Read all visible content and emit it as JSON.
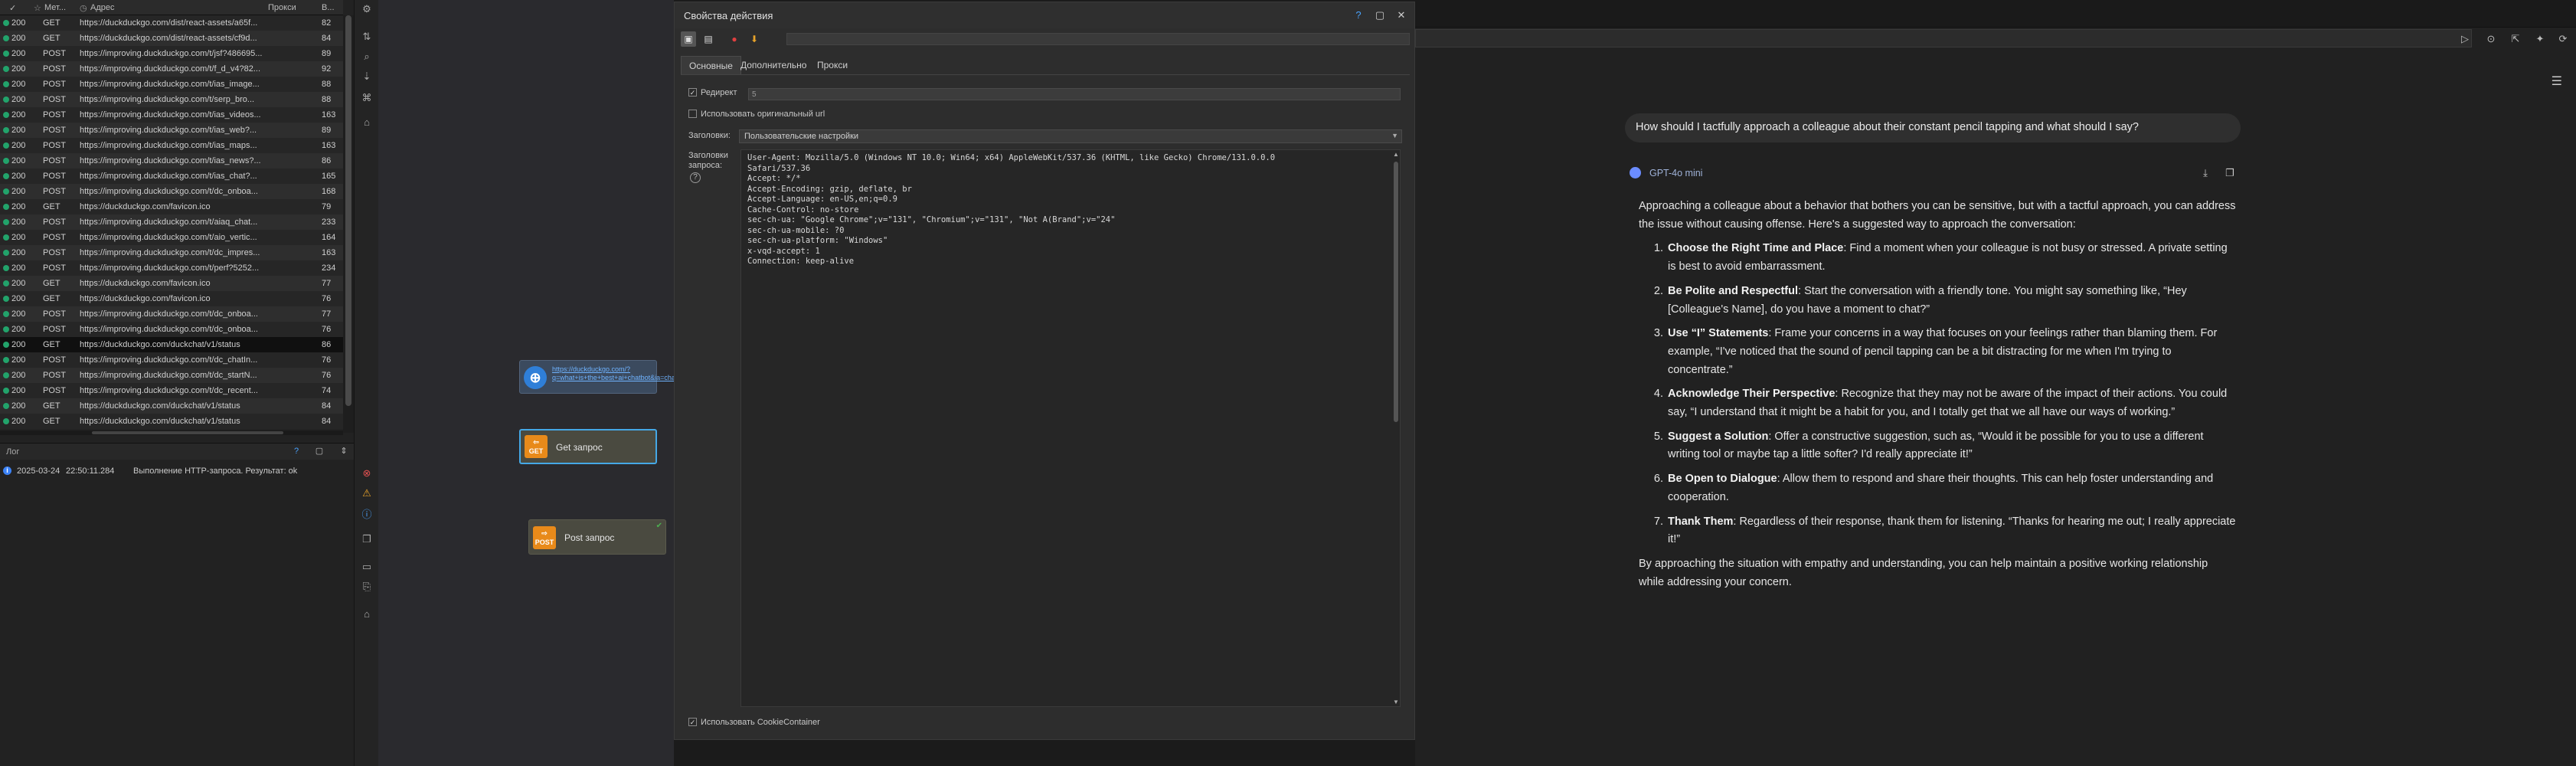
{
  "left_panel": {
    "columns": {
      "check": "✓",
      "method": "Мет...",
      "address": "Адрес",
      "proxy": "Прокси",
      "size": "В..."
    },
    "requests": [
      {
        "status": "200",
        "method": "GET",
        "url": "https://duckduckgo.com/dist/react-assets/a65f...",
        "size": "82",
        "dot": "#22a36b"
      },
      {
        "status": "200",
        "method": "GET",
        "url": "https://duckduckgo.com/dist/react-assets/cf9d...",
        "size": "84",
        "dot": "#22a36b"
      },
      {
        "status": "200",
        "method": "POST",
        "url": "https://improving.duckduckgo.com/t/jsf?486695...",
        "size": "89",
        "dot": "#22a36b"
      },
      {
        "status": "200",
        "method": "POST",
        "url": "https://improving.duckduckgo.com/t/f_d_v4?82...",
        "size": "92",
        "dot": "#22a36b"
      },
      {
        "status": "200",
        "method": "POST",
        "url": "https://improving.duckduckgo.com/t/ias_image...",
        "size": "88",
        "dot": "#22a36b"
      },
      {
        "status": "200",
        "method": "POST",
        "url": "https://improving.duckduckgo.com/t/serp_bro...",
        "size": "88",
        "dot": "#22a36b"
      },
      {
        "status": "200",
        "method": "POST",
        "url": "https://improving.duckduckgo.com/t/ias_videos...",
        "size": "163",
        "dot": "#22a36b"
      },
      {
        "status": "200",
        "method": "POST",
        "url": "https://improving.duckduckgo.com/t/ias_web?...",
        "size": "89",
        "dot": "#22a36b"
      },
      {
        "status": "200",
        "method": "POST",
        "url": "https://improving.duckduckgo.com/t/ias_maps...",
        "size": "163",
        "dot": "#22a36b"
      },
      {
        "status": "200",
        "method": "POST",
        "url": "https://improving.duckduckgo.com/t/ias_news?...",
        "size": "86",
        "dot": "#22a36b"
      },
      {
        "status": "200",
        "method": "POST",
        "url": "https://improving.duckduckgo.com/t/ias_chat?...",
        "size": "165",
        "dot": "#22a36b"
      },
      {
        "status": "200",
        "method": "POST",
        "url": "https://improving.duckduckgo.com/t/dc_onboa...",
        "size": "168",
        "dot": "#22a36b"
      },
      {
        "status": "200",
        "method": "GET",
        "url": "https://duckduckgo.com/favicon.ico",
        "size": "79",
        "dot": "#22a36b"
      },
      {
        "status": "200",
        "method": "POST",
        "url": "https://improving.duckduckgo.com/t/aiaq_chat...",
        "size": "233",
        "dot": "#22a36b"
      },
      {
        "status": "200",
        "method": "POST",
        "url": "https://improving.duckduckgo.com/t/aio_vertic...",
        "size": "164",
        "dot": "#22a36b"
      },
      {
        "status": "200",
        "method": "POST",
        "url": "https://improving.duckduckgo.com/t/dc_impres...",
        "size": "163",
        "dot": "#22a36b"
      },
      {
        "status": "200",
        "method": "POST",
        "url": "https://improving.duckduckgo.com/t/perf?5252...",
        "size": "234",
        "dot": "#22a36b"
      },
      {
        "status": "200",
        "method": "GET",
        "url": "https://duckduckgo.com/favicon.ico",
        "size": "77",
        "dot": "#22a36b"
      },
      {
        "status": "200",
        "method": "GET",
        "url": "https://duckduckgo.com/favicon.ico",
        "size": "76",
        "dot": "#22a36b"
      },
      {
        "status": "200",
        "method": "POST",
        "url": "https://improving.duckduckgo.com/t/dc_onboa...",
        "size": "77",
        "dot": "#22a36b"
      },
      {
        "status": "200",
        "method": "POST",
        "url": "https://improving.duckduckgo.com/t/dc_onboa...",
        "size": "76",
        "dot": "#22a36b"
      },
      {
        "status": "200",
        "method": "GET",
        "url": "https://duckduckgo.com/duckchat/v1/status",
        "size": "86",
        "dot": "#22a36b",
        "selected": true
      },
      {
        "status": "200",
        "method": "POST",
        "url": "https://improving.duckduckgo.com/t/dc_chatIn...",
        "size": "76",
        "dot": "#22a36b"
      },
      {
        "status": "200",
        "method": "POST",
        "url": "https://improving.duckduckgo.com/t/dc_startN...",
        "size": "76",
        "dot": "#22a36b"
      },
      {
        "status": "200",
        "method": "POST",
        "url": "https://improving.duckduckgo.com/t/dc_recent...",
        "size": "74",
        "dot": "#22a36b"
      },
      {
        "status": "200",
        "method": "GET",
        "url": "https://duckduckgo.com/duckchat/v1/status",
        "size": "84",
        "dot": "#22a36b"
      },
      {
        "status": "200",
        "method": "GET",
        "url": "https://duckduckgo.com/duckchat/v1/status",
        "size": "84",
        "dot": "#22a36b"
      }
    ],
    "log": {
      "title": "Лог",
      "entry_time": "2025-03-24",
      "entry_clock": "22:50:11.284",
      "entry_text": "Выполнение HTTP-запроса. Результат: ok"
    }
  },
  "canvas": {
    "url_node_link": "https://duckduckgo.com/?q=what+is+the+best+ai+chatbot&ia=chat",
    "get_node_label": "Get запрос",
    "post_node_label": "Post запрос",
    "get_badge": "GET",
    "post_badge": "POST"
  },
  "dialog": {
    "title": "Свойства действия",
    "tabs": [
      "Основные",
      "Дополнительно",
      "Прокси"
    ],
    "redirect_label": "Редирект",
    "redirect_value": "5",
    "use_original_url_label": "Использовать оригинальный url",
    "headers_label": "Заголовки:",
    "headers_value": "Пользовательские настройки",
    "request_headers_label": "Заголовки запроса:",
    "help_glyph": "?",
    "request_headers": "User-Agent: Mozilla/5.0 (Windows NT 10.0; Win64; x64) AppleWebKit/537.36 (KHTML, like Gecko) Chrome/131.0.0.0\nSafari/537.36\nAccept: */*\nAccept-Encoding: gzip, deflate, br\nAccept-Language: en-US,en;q=0.9\nCache-Control: no-store\nsec-ch-ua: \"Google Chrome\";v=\"131\", \"Chromium\";v=\"131\", \"Not A(Brand\";v=\"24\"\nsec-ch-ua-mobile: ?0\nsec-ch-ua-platform: \"Windows\"\nx-vqd-accept: 1\nConnection: keep-alive",
    "cookie_container_label": "Использовать CookieContainer"
  },
  "chat": {
    "user_message": "How should I tactfully approach a colleague about their constant pencil tapping and what should I say?",
    "model_name": "GPT-4o mini",
    "intro": "Approaching a colleague about a behavior that bothers you can be sensitive, but with a tactful approach, you can address the issue without causing offense. Here's a suggested way to approach the conversation:",
    "steps": [
      {
        "title": "Choose the Right Time and Place",
        "text": ": Find a moment when your colleague is not busy or stressed. A private setting is best to avoid embarrassment."
      },
      {
        "title": "Be Polite and Respectful",
        "text": ": Start the conversation with a friendly tone. You might say something like, “Hey [Colleague's Name], do you have a moment to chat?”"
      },
      {
        "title": "Use “I” Statements",
        "text": ": Frame your concerns in a way that focuses on your feelings rather than blaming them. For example, “I've noticed that the sound of pencil tapping can be a bit distracting for me when I'm trying to concentrate.”"
      },
      {
        "title": "Acknowledge Their Perspective",
        "text": ": Recognize that they may not be aware of the impact of their actions. You could say, “I understand that it might be a habit for you, and I totally get that we all have our ways of working.”"
      },
      {
        "title": "Suggest a Solution",
        "text": ": Offer a constructive suggestion, such as, “Would it be possible for you to use a different writing tool or maybe tap a little softer? I'd really appreciate it!”"
      },
      {
        "title": "Be Open to Dialogue",
        "text": ": Allow them to respond and share their thoughts. This can help foster understanding and cooperation."
      },
      {
        "title": "Thank Them",
        "text": ": Regardless of their response, thank them for listening. “Thanks for hearing me out; I really appreciate it!”"
      }
    ],
    "outro": "By approaching the situation with empathy and understanding, you can help maintain a positive working relationship while addressing your concern."
  },
  "colors": {
    "accent": "#45a8e6",
    "status_ok": "#22a36b",
    "action_orange": "#e88a1a",
    "log_info": "#3b82f6"
  }
}
